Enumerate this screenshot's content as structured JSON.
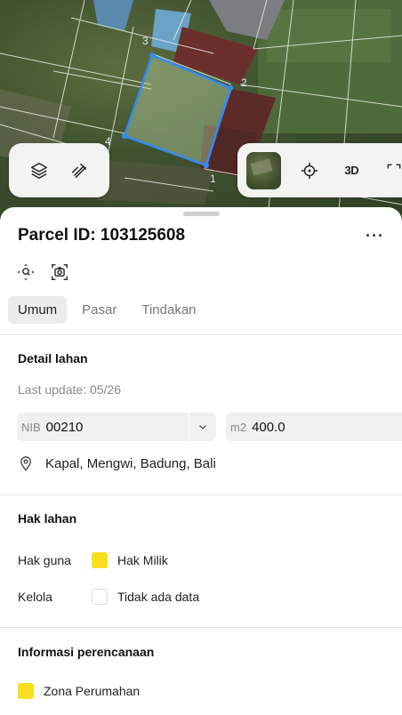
{
  "map": {
    "parcel_corners": [
      "1",
      "2",
      "3",
      "4"
    ],
    "parcel_outline_color": "#2f8cff",
    "controls_left": [
      {
        "name": "layers-icon"
      },
      {
        "name": "measure-icon"
      }
    ],
    "controls_right": {
      "basemap": "satellite-thumbnail",
      "locate": "crosshair-icon",
      "view3d_label": "3D",
      "extra": "fullscreen-icon"
    }
  },
  "parcel": {
    "title": "Parcel ID: 103125608",
    "more": "···"
  },
  "tabs": [
    {
      "label": "Umum",
      "active": true
    },
    {
      "label": "Pasar",
      "active": false
    },
    {
      "label": "Tindakan",
      "active": false
    }
  ],
  "detail": {
    "heading": "Detail lahan",
    "last_update": "Last update: 05/26",
    "nib_prefix": "NIB",
    "nib_value": "00210",
    "area_prefix": "m2",
    "area_value": "400.0",
    "address": "Kapal, Mengwi, Badung, Bali"
  },
  "rights": {
    "heading": "Hak lahan",
    "rows": [
      {
        "key": "Hak guna",
        "value": "Hak Milik",
        "color": "#f8df1e"
      },
      {
        "key": "Kelola",
        "value": "Tidak ada data",
        "color": "#ffffff"
      }
    ]
  },
  "planning": {
    "heading": "Informasi perencanaan",
    "zone": "Zona Perumahan",
    "zone_color": "#f8df1e"
  }
}
